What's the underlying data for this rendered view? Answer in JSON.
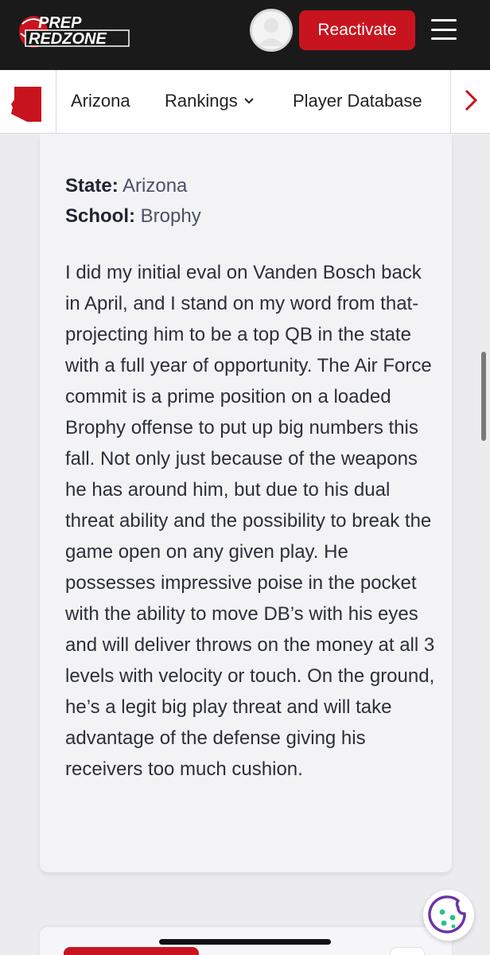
{
  "header": {
    "logo_top": "PREP",
    "logo_bottom": "REDZONE",
    "reactivate_label": "Reactivate"
  },
  "nav": {
    "items": [
      {
        "label": "Arizona"
      },
      {
        "label": "Rankings"
      },
      {
        "label": "Player Database"
      }
    ],
    "chevron": "⌄",
    "next_arrow": "›"
  },
  "card": {
    "state_label": "State:",
    "state_value": "Arizona",
    "school_label": "School:",
    "school_value": "Brophy",
    "evaluation": "I did my initial eval on Vanden Bosch back in April, and I stand on my word from that- projecting him to be a top QB in the state with a full year of opportunity. The Air Force commit is a prime position on a loaded Brophy offense to put up big numbers this fall. Not only just because of the weapons he has around him, but due to his dual threat ability and the possibility to break the game open on any given play. He possesses impressive poise in the pocket with the ability to move DB’s with his eyes and will deliver throws on the money at all 3 levels with velocity or touch. On the ground, he’s a legit big play threat and will take advantage of the defense giving his receivers too much cushion."
  },
  "colors": {
    "brand_red": "#c8141e",
    "header_bg": "#1a1a1a",
    "cookie_purple": "#6a35a8",
    "cookie_green": "#2bbf8a"
  },
  "icons": [
    "logo",
    "avatar-icon",
    "hamburger-icon",
    "arizona-state-icon",
    "chevron-down-icon",
    "chevron-right-icon",
    "cookie-icon"
  ]
}
